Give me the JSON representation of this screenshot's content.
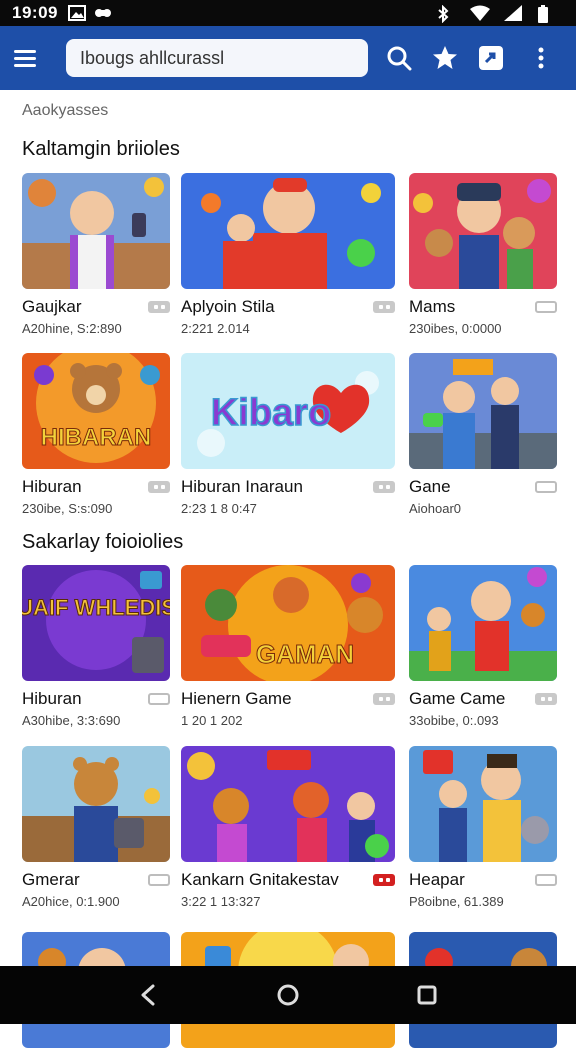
{
  "status_bar": {
    "time": "19:09"
  },
  "search": {
    "value": "Ibougs ahllcurassl"
  },
  "subheader": "Aaokyasses",
  "sections": [
    {
      "title": "Kaltamgin briioles"
    },
    {
      "title": "Sakarlay foioiolies"
    }
  ],
  "cards": [
    {
      "title": "Gaujkar",
      "subtitle": "A20hine, S:2:890",
      "badge": "grey",
      "thumb_text": ""
    },
    {
      "title": "Aplyoin Stila",
      "subtitle": "2:221 2.014",
      "badge": "grey",
      "thumb_text": ""
    },
    {
      "title": "Mams",
      "subtitle": "230ibes, 0:0000",
      "badge": "ring",
      "thumb_text": ""
    },
    {
      "title": "Hiburan",
      "subtitle": "230ibe, S:s:090",
      "badge": "grey",
      "thumb_text": "HIBARAN"
    },
    {
      "title": "Hiburan Inaraun",
      "subtitle": "2:23 1 8 0:47",
      "badge": "grey",
      "thumb_text": "Kibaro"
    },
    {
      "title": "Gane",
      "subtitle": "Aiohoar0",
      "badge": "ring",
      "thumb_text": ""
    },
    {
      "title": "Hiburan",
      "subtitle": "A30hibe, 3:3:690",
      "badge": "ring",
      "thumb_text": "GUAIF WHLEDIS"
    },
    {
      "title": "Hienern Game",
      "subtitle": "1 20 1 202",
      "badge": "grey",
      "thumb_text": "GAMAN"
    },
    {
      "title": "Game Came",
      "subtitle": "33obibe, 0:.093",
      "badge": "grey",
      "thumb_text": ""
    },
    {
      "title": "Gmerar",
      "subtitle": "A20hice, 0:1.900",
      "badge": "ring",
      "thumb_text": ""
    },
    {
      "title": "Kankarn Gnitakestav",
      "subtitle": "3:22 1 13:327",
      "badge": "red",
      "thumb_text": ""
    },
    {
      "title": "Heapar",
      "subtitle": "P8oibne, 61.389",
      "badge": "ring",
      "thumb_text": ""
    }
  ],
  "icons": {
    "menu": "menu-icon",
    "search": "search-icon",
    "star": "star-icon",
    "share": "share-icon",
    "more": "more-vert-icon",
    "back": "back-icon",
    "home": "home-icon",
    "recents": "recents-icon"
  },
  "colors": {
    "app_bar": "#1e4fa8",
    "badge_red": "#d32020"
  }
}
